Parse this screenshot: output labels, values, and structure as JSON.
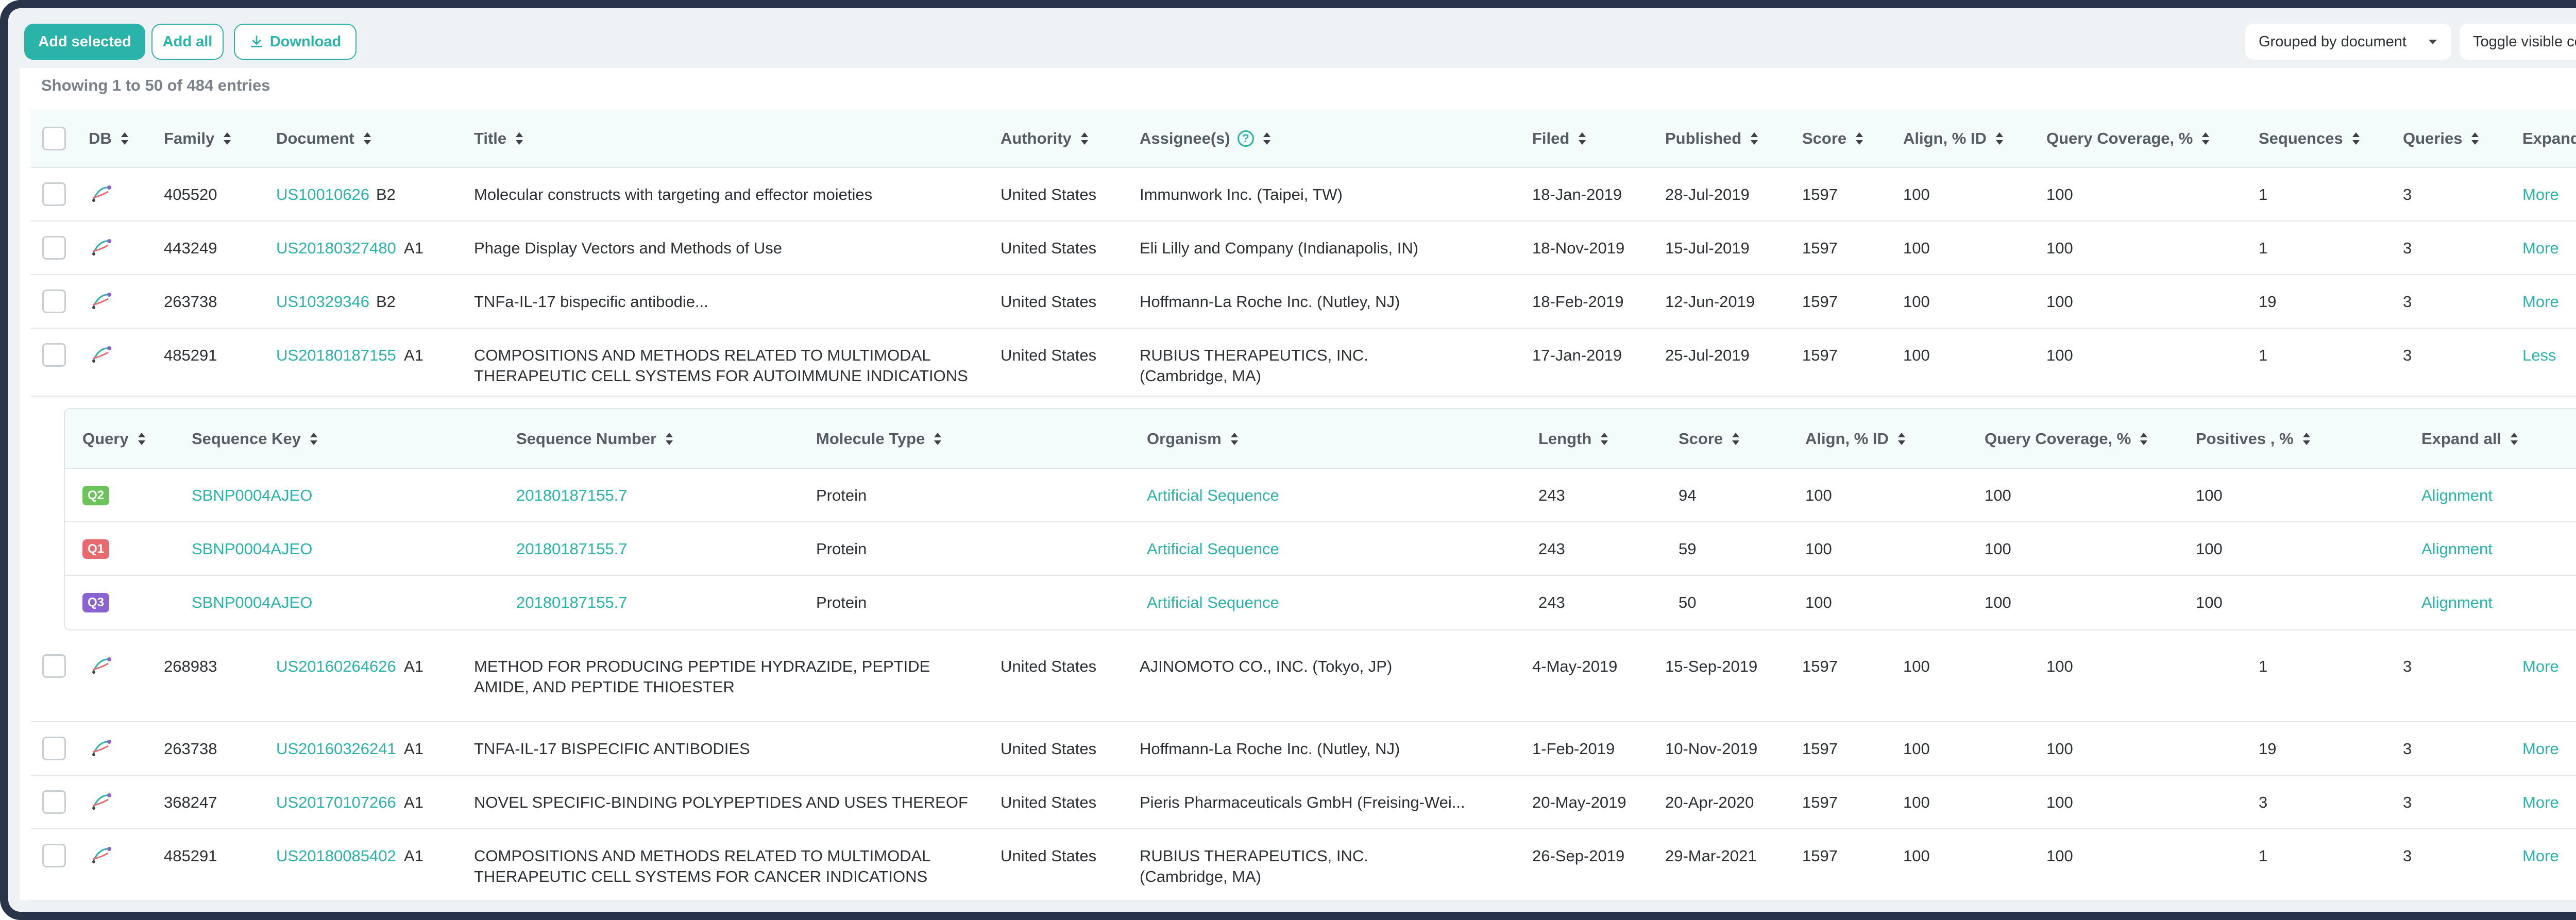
{
  "toolbar": {
    "add_selected": "Add selected",
    "add_all": "Add all",
    "download": "Download",
    "group_by": "Grouped by document",
    "toggle_columns": "Toggle visible columns"
  },
  "entries_text": "Showing 1 to 50 of 484 entries",
  "columns": {
    "db": "DB",
    "family": "Family",
    "document": "Document",
    "title": "Title",
    "authority": "Authority",
    "assignees": "Assignee(s)",
    "filed": "Filed",
    "published": "Published",
    "score": "Score",
    "align_id": "Align, % ID",
    "query_coverage": "Query Coverage, %",
    "sequences": "Sequences",
    "queries": "Queries",
    "expand_all": "Expand all"
  },
  "help_glyph": "?",
  "rows": [
    {
      "family": "405520",
      "doc": "US10010626",
      "kind": "B2",
      "title1": "Molecular constructs with targeting and effector moieties",
      "title2": "",
      "authority": "United States",
      "assignee1": "Immunwork Inc. (Taipei, TW)",
      "assignee2": "",
      "filed": "18-Jan-2019",
      "published": "28-Jul-2019",
      "score": "1597",
      "align": "100",
      "coverage": "100",
      "sequences": "1",
      "queries": "3",
      "action": "More"
    },
    {
      "family": "443249",
      "doc": "US20180327480",
      "kind": "A1",
      "title1": "Phage Display Vectors and Methods of Use",
      "title2": "",
      "authority": "United States",
      "assignee1": "Eli Lilly and Company (Indianapolis, IN)",
      "assignee2": "",
      "filed": "18-Nov-2019",
      "published": "15-Jul-2019",
      "score": "1597",
      "align": "100",
      "coverage": "100",
      "sequences": "1",
      "queries": "3",
      "action": "More"
    },
    {
      "family": "263738",
      "doc": "US10329346",
      "kind": "B2",
      "title1": "TNFa-IL-17 bispecific antibodie...",
      "title2": "",
      "authority": "United States",
      "assignee1": "Hoffmann-La Roche Inc. (Nutley, NJ)",
      "assignee2": "",
      "filed": "18-Feb-2019",
      "published": "12-Jun-2019",
      "score": "1597",
      "align": "100",
      "coverage": "100",
      "sequences": "19",
      "queries": "3",
      "action": "More"
    },
    {
      "family": "485291",
      "doc": "US20180187155",
      "kind": "A1",
      "title1": "COMPOSITIONS AND METHODS RELATED TO MULTIMODAL",
      "title2": "THERAPEUTIC CELL SYSTEMS FOR AUTOIMMUNE INDICATIONS",
      "authority": "United States",
      "assignee1": "RUBIUS THERAPEUTICS, INC.",
      "assignee2": "(Cambridge, MA)",
      "filed": "17-Jan-2019",
      "published": "25-Jul-2019",
      "score": "1597",
      "align": "100",
      "coverage": "100",
      "sequences": "1",
      "queries": "3",
      "action": "Less"
    },
    {
      "family": "268983",
      "doc": "US20160264626",
      "kind": "A1",
      "title1": "METHOD FOR PRODUCING PEPTIDE HYDRAZIDE, PEPTIDE",
      "title2": "AMIDE, AND PEPTIDE THIOESTER",
      "authority": "United States",
      "assignee1": "AJINOMOTO CO., INC. (Tokyo, JP)",
      "assignee2": "",
      "filed": "4-May-2019",
      "published": "15-Sep-2019",
      "score": "1597",
      "align": "100",
      "coverage": "100",
      "sequences": "1",
      "queries": "3",
      "action": "More"
    },
    {
      "family": "263738",
      "doc": "US20160326241",
      "kind": "A1",
      "title1": "TNFA-IL-17 BISPECIFIC ANTIBODIES",
      "title2": "",
      "authority": "United States",
      "assignee1": "Hoffmann-La Roche Inc. (Nutley, NJ)",
      "assignee2": "",
      "filed": "1-Feb-2019",
      "published": "10-Nov-2019",
      "score": "1597",
      "align": "100",
      "coverage": "100",
      "sequences": "19",
      "queries": "3",
      "action": "More"
    },
    {
      "family": "368247",
      "doc": "US20170107266",
      "kind": "A1",
      "title1": "NOVEL SPECIFIC-BINDING POLYPEPTIDES AND USES THEREOF",
      "title2": "",
      "authority": "United States",
      "assignee1": "Pieris Pharmaceuticals GmbH (Freising-Wei...",
      "assignee2": "",
      "filed": "20-May-2019",
      "published": "20-Apr-2020",
      "score": "1597",
      "align": "100",
      "coverage": "100",
      "sequences": "3",
      "queries": "3",
      "action": "More"
    },
    {
      "family": "485291",
      "doc": "US20180085402",
      "kind": "A1",
      "title1": "COMPOSITIONS AND METHODS RELATED TO MULTIMODAL",
      "title2": "THERAPEUTIC CELL SYSTEMS FOR CANCER INDICATIONS",
      "authority": "United States",
      "assignee1": "RUBIUS THERAPEUTICS, INC.",
      "assignee2": "(Cambridge, MA)",
      "filed": "26-Sep-2019",
      "published": "29-Mar-2021",
      "score": "1597",
      "align": "100",
      "coverage": "100",
      "sequences": "1",
      "queries": "3",
      "action": "More"
    }
  ],
  "sub_columns": {
    "query": "Query",
    "seq_key": "Sequence Key",
    "seq_number": "Sequence Number",
    "mol_type": "Molecule Type",
    "organism": "Organism",
    "length": "Length",
    "score": "Score",
    "align_id": "Align, % ID",
    "query_coverage": "Query Coverage, %",
    "positives": "Positives , %",
    "expand_all": "Expand all"
  },
  "sub_rows": [
    {
      "query": "Q2",
      "query_color": "#6cc35a",
      "seq_key": "SBNP0004AJEO",
      "seq_number": "20180187155.7",
      "mol_type": "Protein",
      "organism": "Artificial Sequence",
      "length": "243",
      "score": "94",
      "align": "100",
      "coverage": "100",
      "positives": "100",
      "action": "Alignment"
    },
    {
      "query": "Q1",
      "query_color": "#e86a6f",
      "seq_key": "SBNP0004AJEO",
      "seq_number": "20180187155.7",
      "mol_type": "Protein",
      "organism": "Artificial Sequence",
      "length": "243",
      "score": "59",
      "align": "100",
      "coverage": "100",
      "positives": "100",
      "action": "Alignment"
    },
    {
      "query": "Q3",
      "query_color": "#8a63d2",
      "seq_key": "SBNP0004AJEO",
      "seq_number": "20180187155.7",
      "mol_type": "Protein",
      "organism": "Artificial Sequence",
      "length": "243",
      "score": "50",
      "align": "100",
      "coverage": "100",
      "positives": "100",
      "action": "Alignment"
    }
  ],
  "colors": {
    "accent": "#2ab3a9",
    "frame": "#283548"
  }
}
